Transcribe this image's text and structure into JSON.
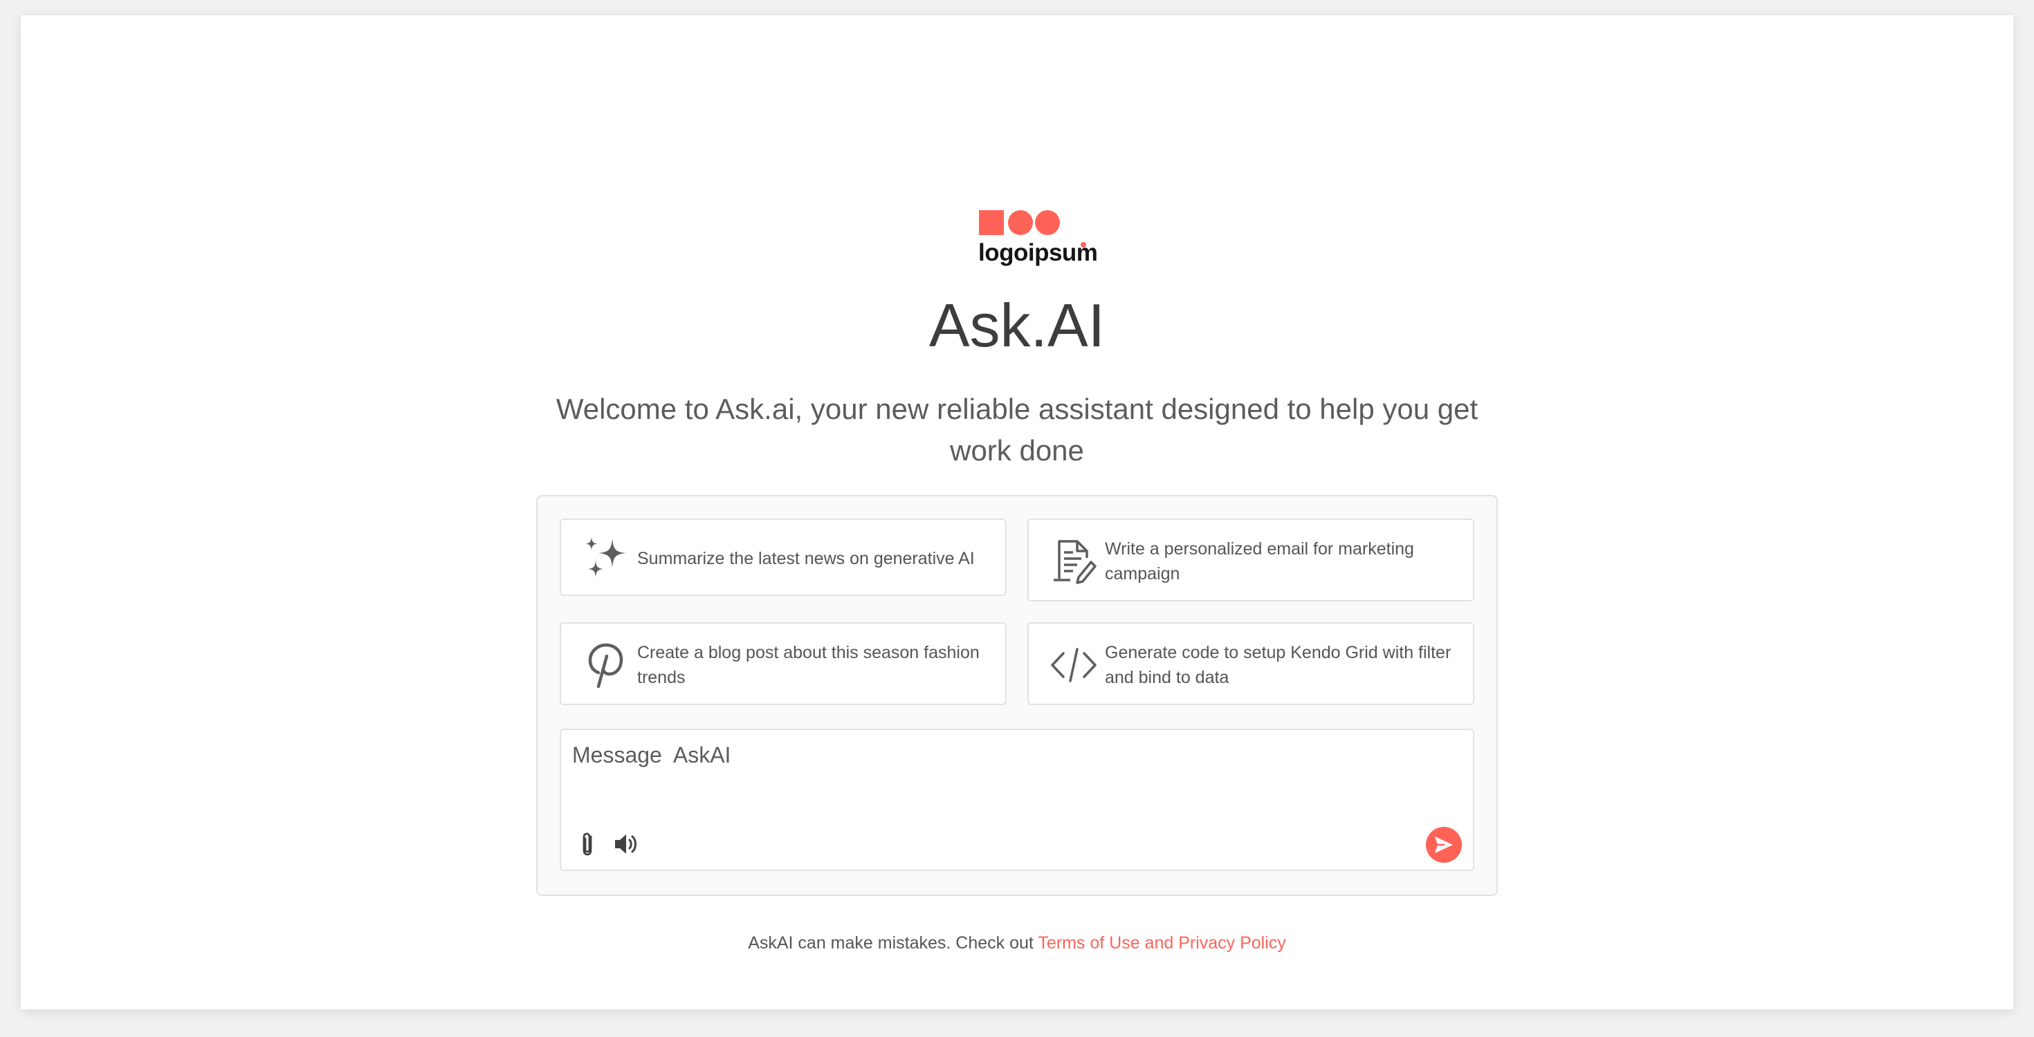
{
  "brand": {
    "logo_text": "logoipsum",
    "accent_color": "#ff6358"
  },
  "title": "Ask.AI",
  "subtitle": "Welcome to Ask.ai, your new reliable assistant designed to help you get work done",
  "suggestions": [
    {
      "icon": "sparkles-icon",
      "text": "Summarize the latest news on generative AI"
    },
    {
      "icon": "document-edit-icon",
      "text": "Write a personalized email for marketing campaign"
    },
    {
      "icon": "pinterest-icon",
      "text": "Create a blog post about this season fashion trends"
    },
    {
      "icon": "code-icon",
      "text": "Generate code to setup Kendo Grid with filter and bind to data"
    }
  ],
  "composer": {
    "placeholder": "Message  AskAI",
    "value": "",
    "tools": [
      "paperclip-icon",
      "speaker-icon"
    ],
    "send_icon": "send-icon"
  },
  "footer": {
    "text": "AskAI can make mistakes. Check out ",
    "link_text": "Terms of Use and Privacy Policy"
  }
}
